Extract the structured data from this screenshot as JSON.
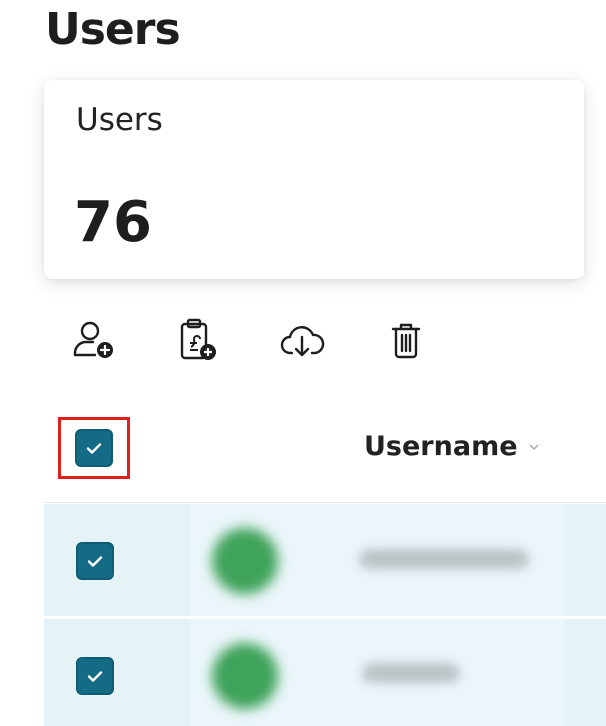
{
  "page": {
    "title": "Users"
  },
  "stat_card": {
    "label": "Users",
    "value": "76"
  },
  "toolbar": {
    "buttons": [
      {
        "icon": "add-user-icon"
      },
      {
        "icon": "clipboard-add-icon"
      },
      {
        "icon": "cloud-download-icon"
      },
      {
        "icon": "trash-icon"
      }
    ]
  },
  "table": {
    "columns": [
      {
        "label": "Username"
      }
    ],
    "select_all_checked": true,
    "rows": [
      {
        "checked": true,
        "avatar_color": "#3fa35a"
      },
      {
        "checked": true,
        "avatar_color": "#3fa35a"
      }
    ]
  },
  "colors": {
    "accent": "#136b86",
    "highlight_border": "#e0201c",
    "row_selected_bg": "#e5f3f7"
  }
}
